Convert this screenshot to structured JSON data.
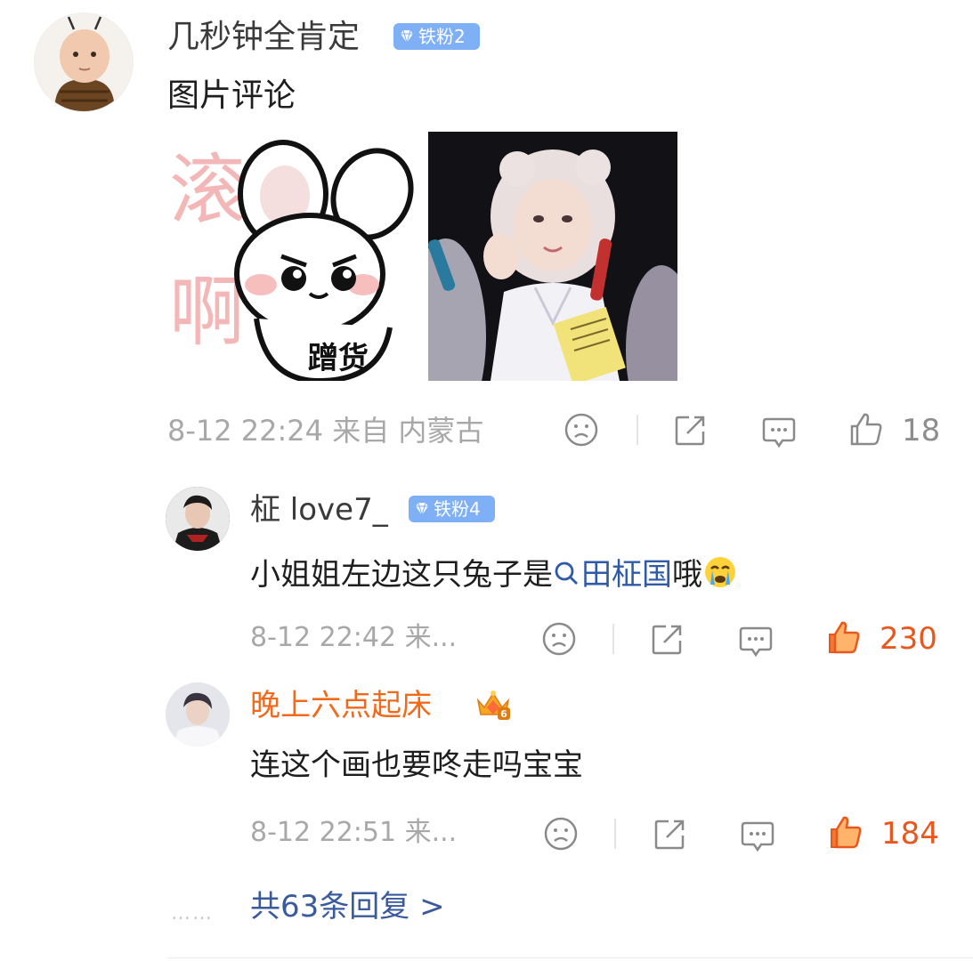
{
  "main_comment": {
    "username": "几秒钟全肯定",
    "badge": "铁粉2",
    "text": "图片评论",
    "image1_caption": "蹭货",
    "image1_bg_text": "滚啊",
    "meta": "8-12 22:24 来自 内蒙古",
    "like_count": "18"
  },
  "replies": [
    {
      "username": "柾 love7_",
      "badge": "铁粉4",
      "text_before": "小姐姐左边这只兔子是",
      "topic": "田柾国",
      "text_after": "哦",
      "meta": "8-12 22:42 来...",
      "like_count": "230"
    },
    {
      "username": "晚上六点起床",
      "crown_level": "6",
      "text": "连这个画也要咚走吗宝宝",
      "meta": "8-12 22:51 来...",
      "like_count": "184"
    }
  ],
  "more_dots": "……",
  "more_replies": "共63条回复 >",
  "colors": {
    "badge_blue": "#7fb0f5",
    "topic_blue": "#2e5aa8",
    "vip_orange": "#f06a1a",
    "like_orange": "#e8571c"
  }
}
